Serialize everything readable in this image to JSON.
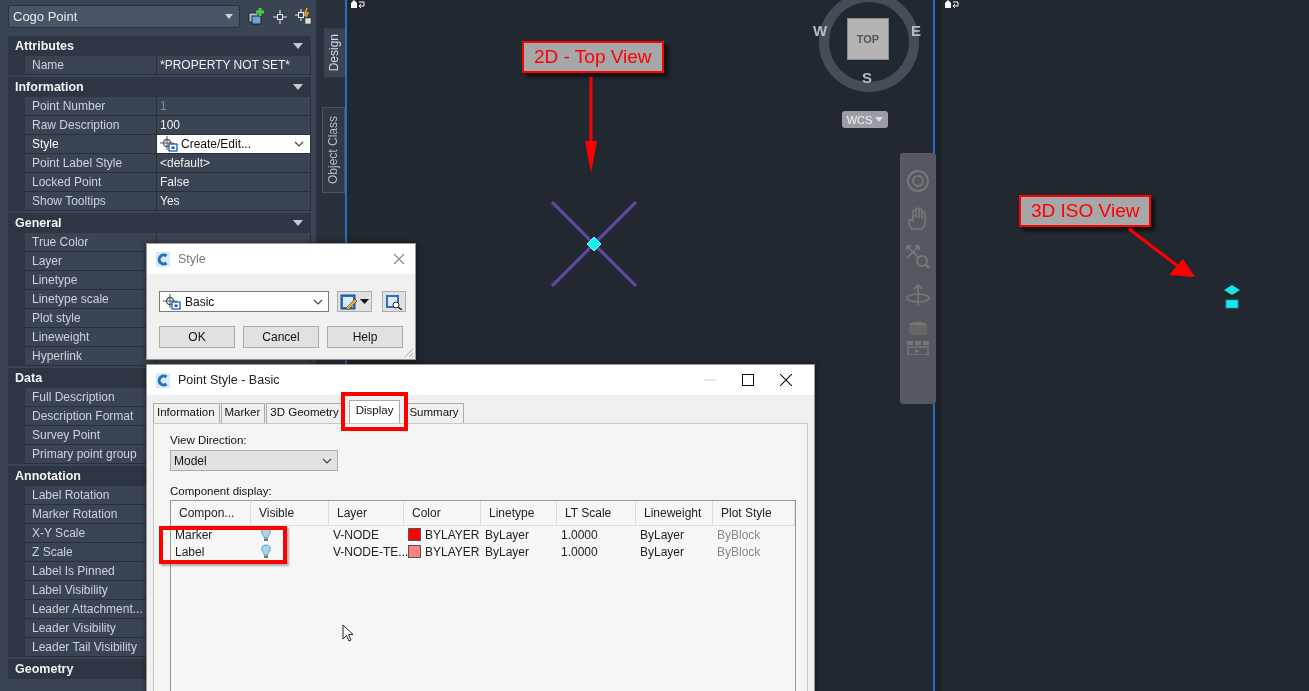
{
  "palette": {
    "object_type": "Cogo Point",
    "sections": [
      {
        "title": "Attributes",
        "expanded": true,
        "rows": [
          {
            "label": "Name",
            "value": "*PROPERTY NOT SET*",
            "kind": "text"
          }
        ]
      },
      {
        "title": "Information",
        "expanded": true,
        "rows": [
          {
            "label": "Point Number",
            "value": "1",
            "kind": "readonly"
          },
          {
            "label": "Raw Description",
            "value": "100",
            "kind": "text"
          },
          {
            "label": "Style",
            "value": "Create/Edit...",
            "kind": "dropdown"
          },
          {
            "label": "Point Label Style",
            "value": "<default>",
            "kind": "text"
          },
          {
            "label": "Locked Point",
            "value": "False",
            "kind": "text"
          },
          {
            "label": "Show Tooltips",
            "value": "Yes",
            "kind": "text"
          }
        ]
      },
      {
        "title": "General",
        "expanded": true,
        "rows": [
          {
            "label": "True Color",
            "kind": "text"
          },
          {
            "label": "Layer",
            "kind": "text"
          },
          {
            "label": "Linetype",
            "kind": "text"
          },
          {
            "label": "Linetype scale",
            "kind": "text"
          },
          {
            "label": "Plot style",
            "kind": "text"
          },
          {
            "label": "Lineweight",
            "kind": "text"
          },
          {
            "label": "Hyperlink",
            "kind": "text"
          }
        ]
      },
      {
        "title": "Data",
        "expanded": true,
        "rows": [
          {
            "label": "Full Description",
            "kind": "text"
          },
          {
            "label": "Description Format",
            "kind": "text"
          },
          {
            "label": "Survey Point",
            "kind": "text"
          },
          {
            "label": "Primary point group",
            "kind": "text"
          }
        ]
      },
      {
        "title": "Annotation",
        "expanded": true,
        "rows": [
          {
            "label": "Label Rotation",
            "kind": "text"
          },
          {
            "label": "Marker Rotation",
            "kind": "text"
          },
          {
            "label": "X-Y Scale",
            "kind": "text"
          },
          {
            "label": "Z Scale",
            "kind": "text"
          },
          {
            "label": "Label Is Pinned",
            "kind": "text"
          },
          {
            "label": "Label Visibility",
            "kind": "text"
          },
          {
            "label": "Leader  Attachment...",
            "kind": "text"
          },
          {
            "label": "Leader Visibility",
            "kind": "text"
          },
          {
            "label": "Leader Tail Visibility",
            "kind": "text"
          }
        ]
      },
      {
        "title": "Geometry",
        "expanded": true
      }
    ],
    "side_tabs": [
      {
        "label": "Design",
        "selected": true
      },
      {
        "label": "Object Class",
        "selected": false
      }
    ]
  },
  "viewport_top": {
    "callout": "2D - Top View",
    "viewcube": {
      "face": "TOP",
      "west": "W",
      "east": "E",
      "south": "S",
      "ucs": "WCS"
    }
  },
  "viewport_iso": {
    "callout": "3D ISO View"
  },
  "style_dialog": {
    "title": "Style",
    "style": "Basic",
    "buttons": [
      "OK",
      "Cancel",
      "Help"
    ]
  },
  "point_style_dialog": {
    "title": "Point Style - Basic",
    "tabs": [
      {
        "label": "Information",
        "selected": false
      },
      {
        "label": "Marker",
        "selected": false
      },
      {
        "label": "3D Geometry",
        "selected": false
      },
      {
        "label": "Display",
        "selected": true
      },
      {
        "label": "Summary",
        "selected": false
      }
    ],
    "view_direction_label": "View Direction:",
    "view_direction": "Model",
    "component_display_label": "Component display:",
    "columns": [
      "Compon...",
      "Visible",
      "Layer",
      "Color",
      "Linetype",
      "LT Scale",
      "Lineweight",
      "Plot Style"
    ],
    "rows": [
      {
        "component": "Marker",
        "visible": true,
        "layer": "V-NODE",
        "color": "#ff0000",
        "color_label": "BYLAYER",
        "linetype": "ByLayer",
        "lt_scale": "1.0000",
        "lineweight": "ByLayer",
        "plot_style": "ByBlock"
      },
      {
        "component": "Label",
        "visible": true,
        "layer": "V-NODE-TE...",
        "color": "#ff8080",
        "color_label": "BYLAYER",
        "linetype": "ByLayer",
        "lt_scale": "1.0000",
        "lineweight": "ByLayer",
        "plot_style": "ByBlock"
      }
    ]
  }
}
